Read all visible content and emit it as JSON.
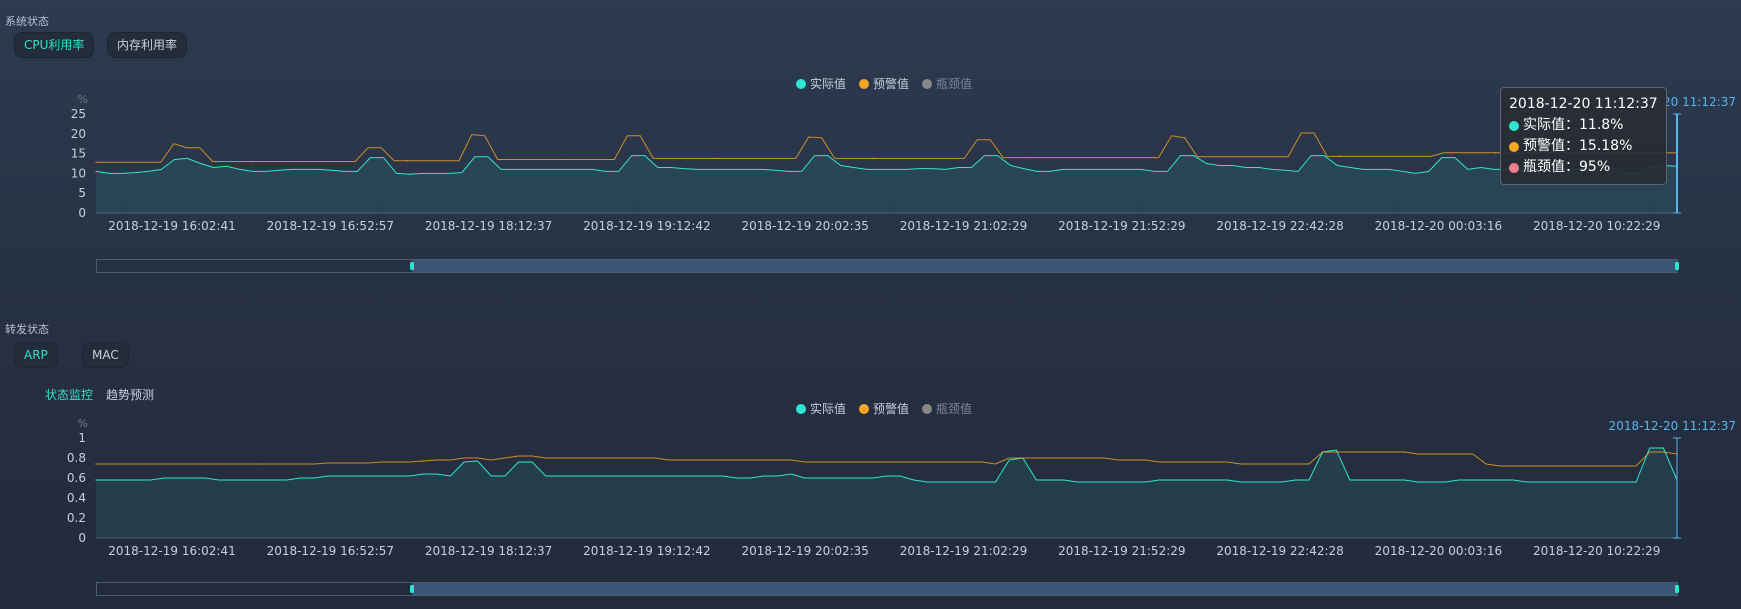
{
  "system": {
    "title": "系统状态",
    "tabs": [
      "CPU利用率",
      "内存利用率"
    ]
  },
  "forward": {
    "title": "转发状态",
    "tabs": [
      "ARP",
      "MAC"
    ],
    "subtabs": [
      "状态监控",
      "趋势预测"
    ]
  },
  "colors": {
    "actual": "#2ee6cf",
    "warning": "#f5a623",
    "bottleneck": "#888888",
    "tooltip_bottleneck": "#f07f8a",
    "axis": "#4a5a70",
    "slider_fill": "#3b5674",
    "cursor": "#59b4ea"
  },
  "tooltip": {
    "time": "2018-12-20 11:12:37",
    "actual": "实际值：11.8%",
    "warning": "预警值：15.18%",
    "bottleneck": "瓶颈值：95%"
  },
  "chart_data": [
    {
      "type": "line",
      "ylabel": "%",
      "ylim": [
        0,
        25
      ],
      "yticks": [
        "0",
        "5",
        "10",
        "15",
        "20",
        "25"
      ],
      "legend": [
        "实际值",
        "预警值",
        "瓶颈值"
      ],
      "legend_position": "top-center",
      "xticks": [
        "2018-12-19 16:02:41",
        "2018-12-19 16:52:57",
        "2018-12-19 18:12:37",
        "2018-12-19 19:12:42",
        "2018-12-19 20:02:35",
        "2018-12-19 21:02:29",
        "2018-12-19 21:52:29",
        "2018-12-19 22:42:28",
        "2018-12-20 00:03:16",
        "2018-12-20 10:22:29"
      ],
      "cursor_label": "2018-12-20 11:12:37",
      "cursor_label_visible": "-12-20 11:12:37",
      "series": [
        {
          "name": "实际值",
          "values": [
            10.5,
            10,
            10,
            10.2,
            10.5,
            11,
            13.5,
            13.8,
            12.5,
            11.5,
            11.8,
            11,
            10.5,
            10.5,
            10.8,
            11,
            11,
            11,
            10.8,
            10.5,
            10.5,
            14,
            14,
            10,
            9.8,
            10,
            10,
            10,
            10.2,
            14.2,
            14.2,
            11,
            11,
            11,
            11,
            11,
            11,
            11,
            11,
            10.5,
            10.5,
            14.5,
            14.5,
            11.5,
            11.5,
            11.2,
            11,
            11,
            11,
            11,
            11,
            11,
            10.8,
            10.5,
            10.5,
            14.5,
            14.5,
            12,
            11.5,
            11,
            11,
            11,
            11,
            11.2,
            11.2,
            11,
            11.5,
            11.5,
            14.5,
            14.5,
            12,
            11.2,
            10.5,
            10.5,
            11,
            11,
            11,
            11,
            11,
            11,
            11,
            10.5,
            10.5,
            14.5,
            14.5,
            12.5,
            12,
            12,
            11.5,
            11.5,
            11,
            10.8,
            10.5,
            14.5,
            14.5,
            12,
            11.5,
            11,
            11,
            11,
            10.5,
            10,
            10.5,
            14,
            14,
            11,
            11.5,
            11,
            11,
            11,
            11,
            11,
            11,
            11,
            11.2,
            11.5,
            11.5,
            10,
            10,
            11.5,
            12,
            11.8
          ]
        },
        {
          "name": "预警值",
          "values": [
            12.8,
            12.8,
            12.8,
            12.8,
            12.8,
            12.8,
            17.5,
            16.5,
            16.5,
            13,
            13,
            13,
            13,
            13,
            13,
            13,
            13,
            13,
            13,
            13,
            13,
            16.5,
            16.5,
            13.2,
            13.2,
            13.2,
            13.2,
            13.2,
            13.2,
            19.8,
            19.5,
            13.5,
            13.5,
            13.5,
            13.5,
            13.5,
            13.5,
            13.5,
            13.5,
            13.5,
            13.5,
            19.5,
            19.5,
            13.8,
            13.8,
            13.8,
            13.8,
            13.8,
            13.8,
            13.8,
            13.8,
            13.8,
            13.8,
            13.8,
            13.8,
            19.2,
            19,
            13.8,
            13.8,
            13.8,
            13.8,
            13.8,
            13.8,
            13.8,
            13.8,
            13.8,
            13.8,
            13.8,
            18.5,
            18.5,
            14,
            14,
            14,
            14,
            14,
            14,
            14,
            14,
            14,
            14,
            14,
            14,
            14,
            19.5,
            19,
            14.2,
            14.2,
            14.2,
            14.2,
            14.2,
            14.2,
            14.2,
            14.2,
            20.2,
            20.2,
            14.3,
            14.3,
            14.3,
            14.3,
            14.3,
            14.3,
            14.3,
            14.3,
            14.3,
            15.2,
            15.2,
            15.2,
            15.2,
            15.2,
            15.2,
            15.2,
            15.2,
            15.2,
            15.2,
            15.2,
            15.2,
            15.2,
            15.2,
            15.2,
            15.2,
            15.2,
            15.2,
            15.18
          ]
        }
      ]
    },
    {
      "type": "line",
      "ylabel": "%",
      "ylim": [
        0,
        1
      ],
      "yticks": [
        "0",
        "0.2",
        "0.4",
        "0.6",
        "0.8",
        "1"
      ],
      "legend": [
        "实际值",
        "预警值",
        "瓶颈值"
      ],
      "legend_position": "top-center",
      "xticks": [
        "2018-12-19 16:02:41",
        "2018-12-19 16:52:57",
        "2018-12-19 18:12:37",
        "2018-12-19 19:12:42",
        "2018-12-19 20:02:35",
        "2018-12-19 21:02:29",
        "2018-12-19 21:52:29",
        "2018-12-19 22:42:28",
        "2018-12-20 00:03:16",
        "2018-12-20 10:22:29"
      ],
      "cursor_label": "2018-12-20 11:12:37",
      "series": [
        {
          "name": "实际值",
          "values": [
            0.58,
            0.58,
            0.58,
            0.58,
            0.58,
            0.6,
            0.6,
            0.6,
            0.6,
            0.58,
            0.58,
            0.58,
            0.58,
            0.58,
            0.58,
            0.6,
            0.6,
            0.62,
            0.62,
            0.62,
            0.62,
            0.62,
            0.62,
            0.62,
            0.64,
            0.64,
            0.62,
            0.76,
            0.77,
            0.62,
            0.62,
            0.76,
            0.76,
            0.62,
            0.62,
            0.62,
            0.62,
            0.62,
            0.62,
            0.62,
            0.62,
            0.62,
            0.62,
            0.62,
            0.62,
            0.62,
            0.62,
            0.6,
            0.6,
            0.62,
            0.62,
            0.64,
            0.6,
            0.6,
            0.6,
            0.6,
            0.6,
            0.6,
            0.62,
            0.62,
            0.58,
            0.56,
            0.56,
            0.56,
            0.56,
            0.56,
            0.56,
            0.78,
            0.8,
            0.58,
            0.58,
            0.58,
            0.56,
            0.56,
            0.56,
            0.56,
            0.56,
            0.56,
            0.58,
            0.58,
            0.58,
            0.58,
            0.58,
            0.58,
            0.56,
            0.56,
            0.56,
            0.56,
            0.58,
            0.58,
            0.86,
            0.88,
            0.58,
            0.58,
            0.58,
            0.58,
            0.58,
            0.56,
            0.56,
            0.56,
            0.58,
            0.58,
            0.58,
            0.58,
            0.58,
            0.56,
            0.56,
            0.56,
            0.56,
            0.56,
            0.56,
            0.56,
            0.56,
            0.56,
            0.9,
            0.9,
            0.58
          ]
        },
        {
          "name": "预警值",
          "values": [
            0.74,
            0.74,
            0.74,
            0.74,
            0.74,
            0.74,
            0.74,
            0.74,
            0.74,
            0.74,
            0.74,
            0.74,
            0.74,
            0.74,
            0.74,
            0.74,
            0.74,
            0.75,
            0.75,
            0.75,
            0.75,
            0.76,
            0.76,
            0.76,
            0.77,
            0.78,
            0.78,
            0.8,
            0.8,
            0.78,
            0.8,
            0.82,
            0.82,
            0.8,
            0.8,
            0.8,
            0.8,
            0.8,
            0.8,
            0.8,
            0.8,
            0.8,
            0.78,
            0.78,
            0.78,
            0.78,
            0.78,
            0.78,
            0.78,
            0.78,
            0.78,
            0.78,
            0.76,
            0.76,
            0.76,
            0.76,
            0.76,
            0.76,
            0.76,
            0.76,
            0.76,
            0.76,
            0.76,
            0.76,
            0.76,
            0.76,
            0.74,
            0.8,
            0.8,
            0.8,
            0.8,
            0.8,
            0.8,
            0.8,
            0.8,
            0.78,
            0.78,
            0.78,
            0.76,
            0.76,
            0.76,
            0.76,
            0.76,
            0.76,
            0.74,
            0.74,
            0.74,
            0.74,
            0.74,
            0.74,
            0.86,
            0.86,
            0.86,
            0.86,
            0.86,
            0.86,
            0.86,
            0.84,
            0.84,
            0.84,
            0.84,
            0.84,
            0.74,
            0.72,
            0.72,
            0.72,
            0.72,
            0.72,
            0.72,
            0.72,
            0.72,
            0.72,
            0.72,
            0.72,
            0.86,
            0.86,
            0.84
          ]
        }
      ]
    }
  ]
}
